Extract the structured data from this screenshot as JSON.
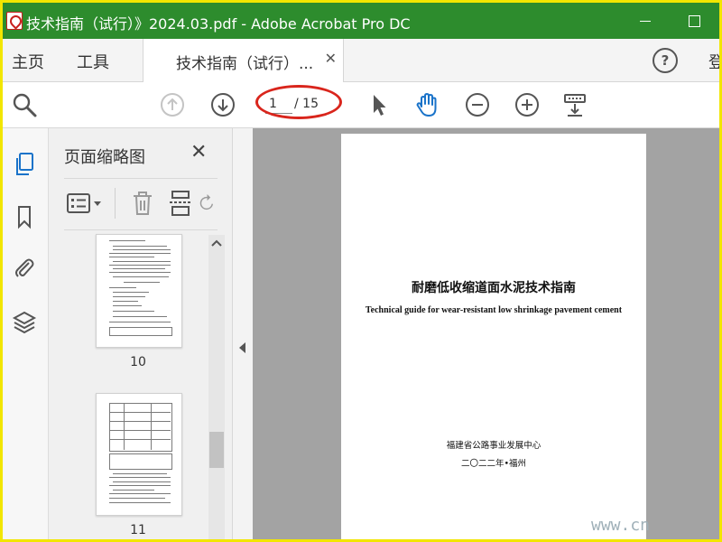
{
  "window": {
    "title": "技术指南（试行）》2024.03.pdf - Adobe Acrobat Pro DC"
  },
  "tabbar": {
    "home": "主页",
    "tools": "工具",
    "doc_tab": "技术指南（试行）...",
    "signin": "登"
  },
  "toolbar": {
    "current_page": "1",
    "page_total": "/ 15"
  },
  "panel": {
    "title": "页面缩略图",
    "thumbnails": [
      {
        "label": "10"
      },
      {
        "label": "11"
      }
    ]
  },
  "document": {
    "title_cn": "耐磨低收缩道面水泥技术指南",
    "title_en": "Technical guide for wear-resistant low shrinkage pavement cement",
    "organization": "福建省公路事业发展中心",
    "date": "二〇二二年•福州"
  },
  "overlay": {
    "watermark": "www.cn"
  },
  "colors": {
    "titlebar": "#2d8c2d",
    "frame": "#f2e600",
    "annotation": "#d9251c",
    "accent_blue": "#1a73c9"
  },
  "icons": {
    "search": "magnifier-icon",
    "prev_page": "arrow-up-circle-icon",
    "next_page": "arrow-down-circle-icon",
    "select": "cursor-arrow-icon",
    "hand": "hand-icon",
    "zoom_out": "minus-circle-icon",
    "zoom_in": "plus-circle-icon"
  }
}
